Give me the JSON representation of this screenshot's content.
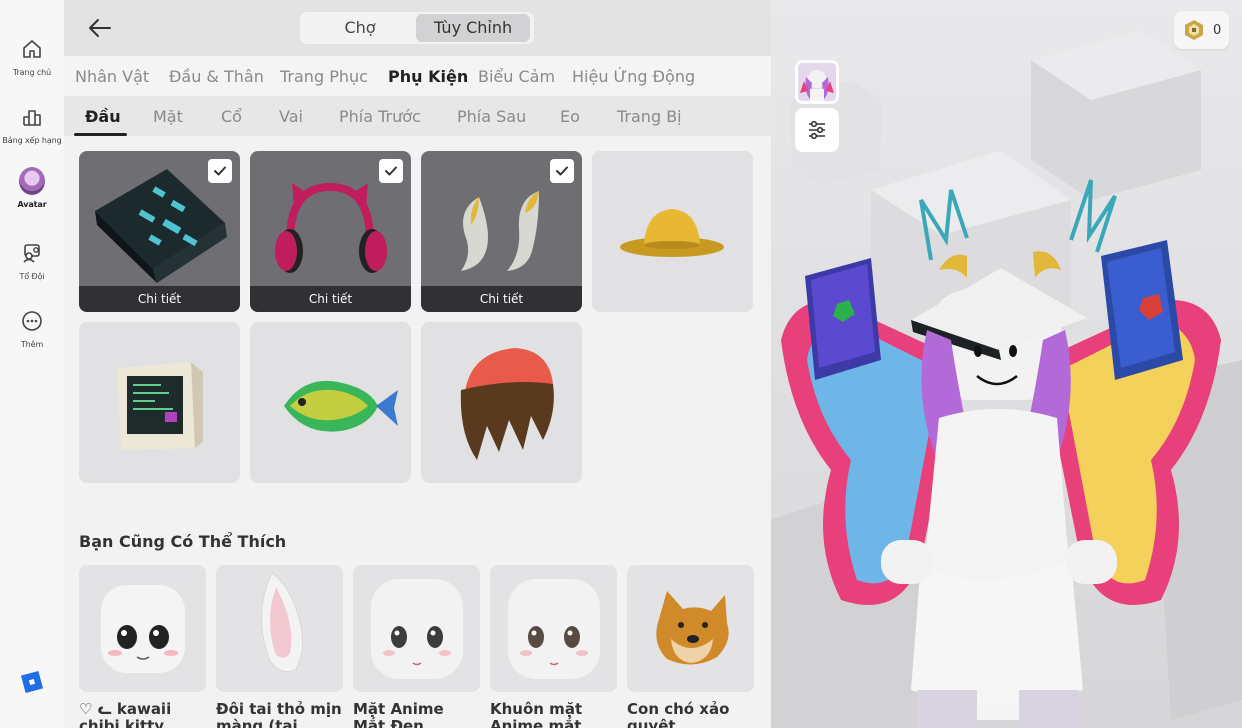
{
  "nav": {
    "items": [
      {
        "label": "Trang chủ",
        "icon": "home-icon"
      },
      {
        "label": "Bảng xếp hạng",
        "icon": "leaderboard-icon"
      },
      {
        "label": "Avatar",
        "icon": "avatar-icon"
      },
      {
        "label": "Tổ Đội",
        "icon": "party-icon"
      },
      {
        "label": "Thêm",
        "icon": "more-icon"
      }
    ],
    "active": "Avatar"
  },
  "header": {
    "segments": [
      "Chợ",
      "Tùy Chỉnh"
    ],
    "selected_segment": "Tùy Chỉnh"
  },
  "categories": [
    "Nhân Vật",
    "Đầu & Thân",
    "Trang Phục",
    "Phụ Kiện",
    "Biểu Cảm",
    "Hiệu Ứng Động"
  ],
  "active_category": "Phụ Kiện",
  "subcategories": [
    "Đầu",
    "Mặt",
    "Cổ",
    "Vai",
    "Phía Trước",
    "Phía Sau",
    "Eo",
    "Trang Bị"
  ],
  "active_subcategory": "Đầu",
  "items": [
    {
      "icon": "book-hat-icon",
      "selected": true,
      "detail_label": "Chi tiết"
    },
    {
      "icon": "cat-headphones-icon",
      "selected": true,
      "detail_label": "Chi tiết"
    },
    {
      "icon": "horns-icon",
      "selected": true,
      "detail_label": "Chi tiết"
    },
    {
      "icon": "yellow-bucket-hat-icon",
      "selected": false
    },
    {
      "icon": "crt-monitor-hat-icon",
      "selected": false
    },
    {
      "icon": "fish-hat-icon",
      "selected": false
    },
    {
      "icon": "beanie-hair-icon",
      "selected": false
    }
  ],
  "recommendations": {
    "title": "Bạn Cũng Có Thể Thích",
    "items": [
      {
        "name": "♡ ᓚ kawaii chibi kitty fang ani…",
        "icon": "kawaii-face-icon"
      },
      {
        "name": "Đôi tai thỏ mịn màng (tai mới…",
        "icon": "bunny-ear-icon"
      },
      {
        "name": "Mặt Anime Mắt Đen Mềm…",
        "icon": "anime-face-icon"
      },
      {
        "name": "Khuôn mặt Anime mắt nâu…",
        "icon": "anime-face-brown-icon"
      },
      {
        "name": "Con chó xảo quyệt…",
        "icon": "doge-head-icon"
      }
    ]
  },
  "currency": {
    "value": "0",
    "icon": "robux-icon"
  },
  "colors": {
    "accent": "#222222",
    "sidebar": "#f7f7f8",
    "panel": "#f2f2f3",
    "selected_tile": "#6f6f73"
  }
}
